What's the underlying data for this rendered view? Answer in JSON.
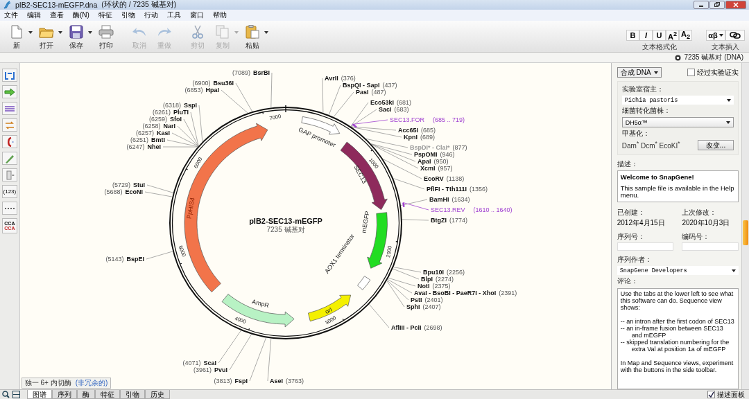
{
  "window": {
    "title": "pIB2-SEC13-mEGFP.dna",
    "subtitle": "(环状的 / 7235 碱基对)"
  },
  "menu": [
    "文件",
    "编辑",
    "查看",
    "酶(N)",
    "特征",
    "引物",
    "行动",
    "工具",
    "窗口",
    "帮助"
  ],
  "toolbar": [
    {
      "kind": "new",
      "label": "新",
      "dropdown": true,
      "disabled": false
    },
    {
      "kind": "open",
      "label": "打开",
      "dropdown": true,
      "disabled": false
    },
    {
      "kind": "save",
      "label": "保存",
      "dropdown": true,
      "disabled": false
    },
    {
      "kind": "print",
      "label": "打印",
      "dropdown": false,
      "disabled": false
    },
    {
      "kind": "undo",
      "label": "取消",
      "dropdown": false,
      "disabled": true
    },
    {
      "kind": "redo",
      "label": "重做",
      "dropdown": false,
      "disabled": true
    },
    {
      "kind": "cut",
      "label": "剪切",
      "dropdown": false,
      "disabled": true
    },
    {
      "kind": "copy",
      "label": "复制",
      "dropdown": true,
      "disabled": true
    },
    {
      "kind": "paste",
      "label": "粘贴",
      "dropdown": true,
      "disabled": false
    }
  ],
  "text_format": {
    "buttons": [
      "B",
      "*I*",
      "U",
      "A$^{2}$",
      "A$_{2}$"
    ],
    "label": "文本格式化"
  },
  "text_insert": {
    "symbol": "αβ",
    "label": "文本插入"
  },
  "status": "7235 碱基对 (DNA)",
  "side_toolbar": {
    "numbers": "(123)",
    "codon_top": "CCA",
    "codon_bottom": "CCA"
  },
  "map": {
    "name": "pIB2-SEC13-mEGFP",
    "length": "7235 碱基对",
    "ticks": [
      "1000",
      "2000",
      "3000",
      "4000",
      "5000",
      "6000",
      "7000"
    ],
    "features": [
      {
        "name": "GAP promoter",
        "kind": "arrow",
        "color": "#ffffff"
      },
      {
        "name": "SEC13",
        "kind": "arrow",
        "color": "#8e2a5c"
      },
      {
        "name": "mEGFP",
        "kind": "arrow",
        "color": "#22dd22"
      },
      {
        "name": "AOX1 terminator",
        "kind": "box",
        "color": "#ffffff"
      },
      {
        "name": "ori",
        "kind": "arrow",
        "color": "#f4f000"
      },
      {
        "name": "AmpR",
        "kind": "arrow",
        "color": "#b8f2c4"
      },
      {
        "name": "PpHIS4",
        "kind": "arrow",
        "color": "#f2744a"
      }
    ],
    "primers": [
      {
        "name": "SEC13.FOR",
        "range": "(685 .. 719)"
      },
      {
        "name": "SEC13.REV",
        "range": "(1610 .. 1640)"
      }
    ],
    "enzymes": [
      {
        "name": "BsrBI",
        "position": "(7089)",
        "blocked": false
      },
      {
        "name": "Bsu36I",
        "position": "(6900)",
        "blocked": false
      },
      {
        "name": "HpaI",
        "position": "(6853)",
        "blocked": false
      },
      {
        "name": "SspI",
        "position": "(6318)",
        "blocked": false
      },
      {
        "name": "PluTI",
        "position": "(6261)",
        "blocked": false
      },
      {
        "name": "SfoI",
        "position": "(6259)",
        "blocked": false
      },
      {
        "name": "NarI",
        "position": "(6258)",
        "blocked": false
      },
      {
        "name": "KasI",
        "position": "(6257)",
        "blocked": false
      },
      {
        "name": "BmtI",
        "position": "(6251)",
        "blocked": false
      },
      {
        "name": "NheI",
        "position": "(6247)",
        "blocked": false
      },
      {
        "name": "StuI",
        "position": "(5729)",
        "blocked": false
      },
      {
        "name": "EcoNI",
        "position": "(5688)",
        "blocked": false
      },
      {
        "name": "BspEI",
        "position": "(5143)",
        "blocked": false
      },
      {
        "name": "AvrII",
        "position": "(376)",
        "blocked": false
      },
      {
        "name": "BspQI - SapI",
        "position": "(437)",
        "blocked": false
      },
      {
        "name": "PasI",
        "position": "(487)",
        "blocked": false
      },
      {
        "name": "Eco53kI",
        "position": "(681)",
        "blocked": false
      },
      {
        "name": "SacI",
        "position": "(683)",
        "blocked": false
      },
      {
        "name": "Acc65I",
        "position": "(685)",
        "blocked": false
      },
      {
        "name": "KpnI",
        "position": "(689)",
        "blocked": false
      },
      {
        "name": "BspDI* - ClaI*",
        "position": "(877)",
        "blocked": true
      },
      {
        "name": "PspOMI",
        "position": "(946)",
        "blocked": false
      },
      {
        "name": "ApaI",
        "position": "(950)",
        "blocked": false
      },
      {
        "name": "XcmI",
        "position": "(957)",
        "blocked": false
      },
      {
        "name": "EcoRV",
        "position": "(1138)",
        "blocked": false
      },
      {
        "name": "PflFI - Tth111I",
        "position": "(1356)",
        "blocked": false
      },
      {
        "name": "BamHI",
        "position": "(1634)",
        "blocked": false
      },
      {
        "name": "BtgZI",
        "position": "(1774)",
        "blocked": false
      },
      {
        "name": "Bpu10I",
        "position": "(2256)",
        "blocked": false
      },
      {
        "name": "BlpI",
        "position": "(2274)",
        "blocked": false
      },
      {
        "name": "NotI",
        "position": "(2375)",
        "blocked": false
      },
      {
        "name": "AvaI - BsoBI - PaeR7I - XhoI",
        "position": "(2391)",
        "blocked": false
      },
      {
        "name": "PstI",
        "position": "(2401)",
        "blocked": false
      },
      {
        "name": "SphI",
        "position": "(2407)",
        "blocked": false
      },
      {
        "name": "AflIII - PciI",
        "position": "(2698)",
        "blocked": false
      },
      {
        "name": "ScaI",
        "position": "(4071)",
        "blocked": false
      },
      {
        "name": "PvuI",
        "position": "(3961)",
        "blocked": false
      },
      {
        "name": "FspI",
        "position": "(3813)",
        "blocked": false
      },
      {
        "name": "AseI",
        "position": "(3763)",
        "blocked": false
      }
    ],
    "enzyme_set": {
      "label": "独一 6+ 内切酶",
      "link": "(非冗余的)"
    }
  },
  "panel": {
    "topology": "合成 DNA",
    "verified": {
      "label": "经过实验证实",
      "checked": false
    },
    "host": {
      "label": "实验室宿主：",
      "value": "Pichia pastoris"
    },
    "strain": {
      "label": "细菌转化菌株：",
      "value": "DH5α™"
    },
    "methylation": {
      "label": "甲基化：",
      "value": "Dam$^{*}$ Dcm$^{*}$ EcoKI$^{*}$",
      "button": "改变..."
    },
    "description": {
      "label": "描述：",
      "title": "Welcome to SnapGene!",
      "text": "This sample file is available in the Help menu."
    },
    "created": {
      "label": "已创建：",
      "value": "2012年4月15日"
    },
    "modified": {
      "label": "上次修改：",
      "value": "2020年10月3日"
    },
    "serial": {
      "label": "序列号："
    },
    "code": {
      "label": "编码号："
    },
    "author": {
      "label": "序列作者：",
      "value": "SnapGene Developers"
    },
    "comments": {
      "label": "评论：",
      "paragraphs": [
        {
          "kind": "para",
          "text": "Use the tabs at the lower left to see what this software can do. Sequence view shows:"
        },
        {
          "kind": "bullet",
          "text": "-- an intron after the first codon of SEC13"
        },
        {
          "kind": "bullet",
          "text": "-- an in-frame fusion between SEC13 and mEGFP"
        },
        {
          "kind": "bullet",
          "text": "-- skipped translation numbering for the extra Val at position 1a of mEGFP"
        },
        {
          "kind": "para",
          "text": "In Map and Sequence views, experiment with the buttons in the side toolbar."
        }
      ]
    }
  },
  "tabs": [
    {
      "label": "图谱",
      "selected": true
    },
    {
      "label": "序列",
      "selected": false
    },
    {
      "label": "酶",
      "selected": false
    },
    {
      "label": "特征",
      "selected": false
    },
    {
      "label": "引物",
      "selected": false
    },
    {
      "label": "历史",
      "selected": false
    }
  ],
  "panel_toggle": {
    "label": "描述面板",
    "checked": true
  }
}
